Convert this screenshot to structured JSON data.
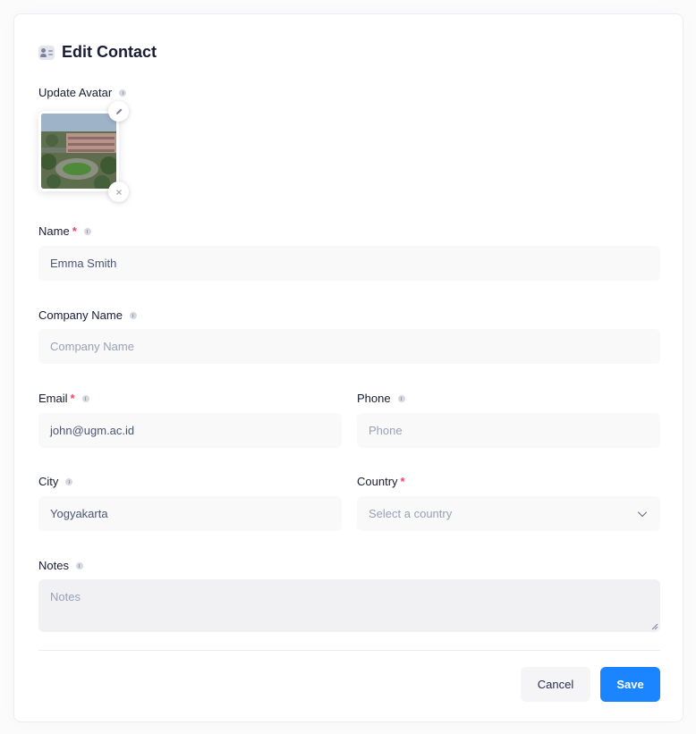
{
  "header": {
    "title": "Edit Contact",
    "icon": "contact-card-icon"
  },
  "avatar": {
    "label": "Update Avatar",
    "edit_icon": "pencil-icon",
    "remove_icon": "close-icon"
  },
  "form": {
    "name": {
      "label": "Name",
      "required": true,
      "value": "Emma Smith",
      "placeholder": ""
    },
    "company": {
      "label": "Company Name",
      "required": false,
      "value": "",
      "placeholder": "Company Name"
    },
    "email": {
      "label": "Email",
      "required": true,
      "value": "john@ugm.ac.id",
      "placeholder": ""
    },
    "phone": {
      "label": "Phone",
      "required": false,
      "value": "",
      "placeholder": "Phone"
    },
    "city": {
      "label": "City",
      "required": false,
      "value": "Yogyakarta",
      "placeholder": ""
    },
    "country": {
      "label": "Country",
      "required": true,
      "value": "",
      "placeholder": "Select a country"
    },
    "notes": {
      "label": "Notes",
      "required": false,
      "value": "",
      "placeholder": "Notes"
    }
  },
  "actions": {
    "cancel_label": "Cancel",
    "save_label": "Save"
  },
  "colors": {
    "primary": "#1b84ff",
    "required": "#f1416c",
    "input_bg": "#f9f9f9"
  }
}
